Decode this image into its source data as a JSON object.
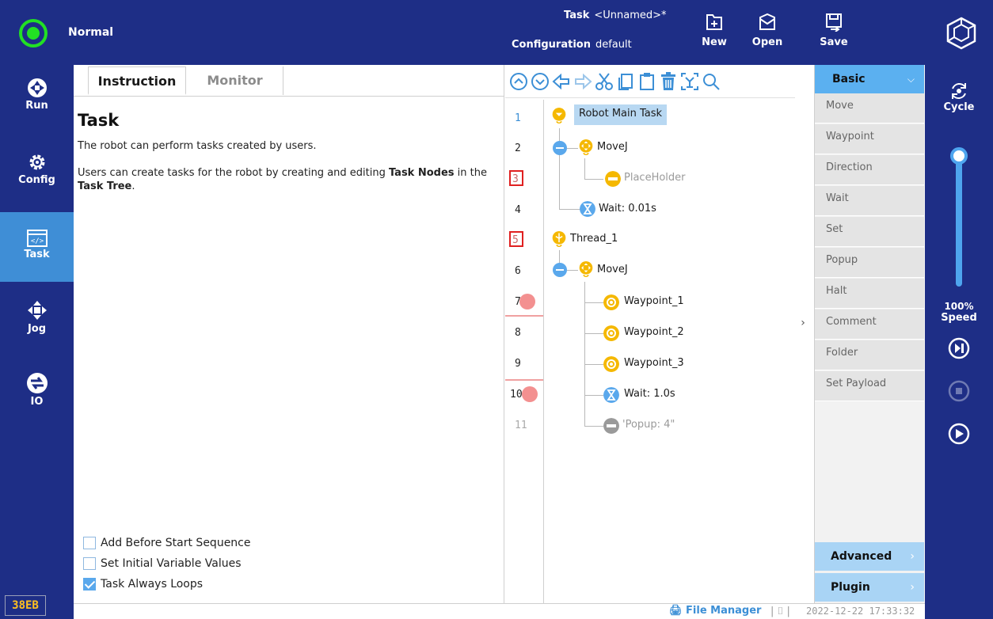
{
  "header": {
    "mode": "Normal",
    "task_label": "Task",
    "task_name": "<Unnamed>*",
    "config_label": "Configuration",
    "config_value": "default",
    "new_label": "New",
    "open_label": "Open",
    "save_label": "Save",
    "status_color": "#22e024"
  },
  "leftnav": {
    "items": [
      {
        "label": "Run",
        "icon": "run-icon"
      },
      {
        "label": "Config",
        "icon": "gear-icon"
      },
      {
        "label": "Task",
        "icon": "code-window-icon"
      },
      {
        "label": "Jog",
        "icon": "move-arrows-icon"
      },
      {
        "label": "IO",
        "icon": "io-arrows-icon"
      }
    ],
    "active": "Task",
    "badge": "38EB"
  },
  "instruction": {
    "tabs": [
      "Instruction",
      "Monitor"
    ],
    "active_tab": "Instruction",
    "title": "Task",
    "para1": "The robot can perform tasks created by users.",
    "para2_a": "Users can create tasks for the robot by creating and editing ",
    "para2_b": "Task Nodes",
    "para2_c": " in the ",
    "para2_d": "Task Tree",
    "para2_e": ".",
    "checkboxes": [
      {
        "label": "Add Before Start Sequence",
        "checked": false
      },
      {
        "label": "Set Initial Variable Values",
        "checked": false
      },
      {
        "label": "Task Always Loops",
        "checked": true
      }
    ]
  },
  "toolbar": {
    "icons": [
      "move-up-icon",
      "move-down-icon",
      "undo-icon",
      "redo-icon",
      "cut-icon",
      "copy-icon",
      "paste-icon",
      "delete-icon",
      "suppress-icon",
      "search-icon"
    ]
  },
  "tree": {
    "lines": [
      {
        "num": "1",
        "style": "blue"
      },
      {
        "num": "2",
        "style": "normal"
      },
      {
        "num": "3",
        "style": "redbox"
      },
      {
        "num": "4",
        "style": "normal"
      },
      {
        "num": "5",
        "style": "redbox"
      },
      {
        "num": "6",
        "style": "normal"
      },
      {
        "num": "7",
        "style": "breakpoint"
      },
      {
        "num": "8",
        "style": "normal"
      },
      {
        "num": "9",
        "style": "normal"
      },
      {
        "num": "10",
        "style": "breakpoint"
      },
      {
        "num": "11",
        "style": "grey"
      }
    ],
    "nodes": [
      {
        "label": "Robot Main Task",
        "icon": "main-task-icon",
        "selected": true
      },
      {
        "label": "MoveJ",
        "icon": "movej-icon"
      },
      {
        "label": "PlaceHolder",
        "icon": "placeholder-icon",
        "disabled": true
      },
      {
        "label": "Wait: 0.01s",
        "icon": "hourglass-icon"
      },
      {
        "label": "Thread_1",
        "icon": "thread-icon"
      },
      {
        "label": "MoveJ",
        "icon": "movej-icon"
      },
      {
        "label": "Waypoint_1",
        "icon": "waypoint-icon"
      },
      {
        "label": "Waypoint_2",
        "icon": "waypoint-icon"
      },
      {
        "label": "Waypoint_3",
        "icon": "waypoint-icon"
      },
      {
        "label": "Wait: 1.0s",
        "icon": "hourglass-icon"
      },
      {
        "label": "'Popup: 4\"",
        "icon": "popup-icon",
        "disabled": true
      }
    ]
  },
  "palette": {
    "header": "Basic",
    "items": [
      "Move",
      "Waypoint",
      "Direction",
      "Wait",
      "Set",
      "Popup",
      "Halt",
      "Comment",
      "Folder",
      "Set Payload"
    ],
    "advanced": "Advanced",
    "plugin": "Plugin"
  },
  "rightrail": {
    "cycle": "Cycle",
    "speed_value": "100%",
    "speed_label": "Speed",
    "speed_fraction": 1.0
  },
  "statusbar": {
    "file_manager": "File Manager",
    "timestamp": "2022-12-22 17:33:32"
  },
  "colors": {
    "navy": "#1e2e86",
    "accent_blue": "#5bb0f0",
    "node_yellow": "#f5b800",
    "breakpoint": "#f39090"
  }
}
